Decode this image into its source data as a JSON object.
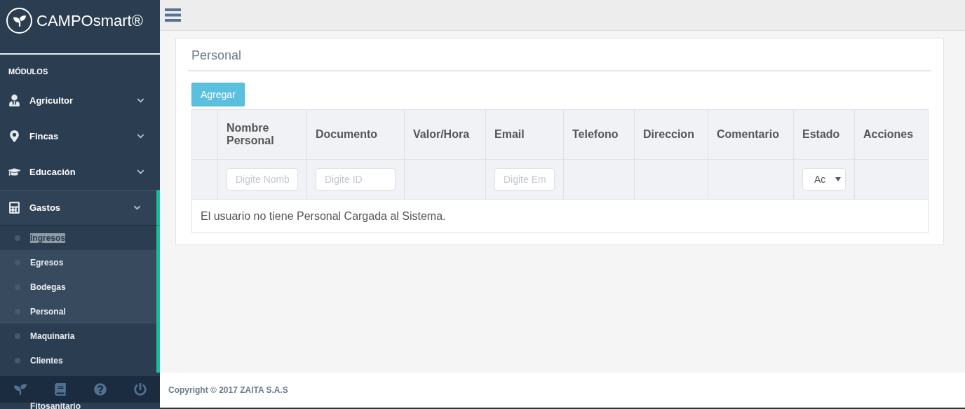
{
  "brand": {
    "name": "CAMPOsmart®"
  },
  "sidebar": {
    "section_title": "MÓDULOS",
    "items": [
      {
        "kind": "person",
        "label": "Agricultor",
        "expanded": false
      },
      {
        "kind": "pin",
        "label": "Fincas",
        "expanded": false
      },
      {
        "kind": "cap",
        "label": "Educación",
        "expanded": false
      },
      {
        "kind": "calculator",
        "label": "Gastos",
        "expanded": true,
        "children": [
          {
            "label": "Ingresos",
            "shaded": false,
            "text_selected": true
          },
          {
            "label": "Egresos",
            "shaded": true,
            "text_selected": false
          },
          {
            "label": "Bodegas",
            "shaded": true,
            "text_selected": false
          },
          {
            "label": "Personal",
            "shaded": true,
            "text_selected": false
          },
          {
            "label": "Maquinaria",
            "shaded": false,
            "text_selected": false
          },
          {
            "label": "Clientes",
            "shaded": false,
            "text_selected": false
          }
        ]
      }
    ],
    "below_bar_item": "Fitosanitario"
  },
  "panel": {
    "title": "Personal",
    "add_button": "Agregar",
    "table": {
      "columns": [
        "",
        "Nombre Personal",
        "Documento",
        "Valor/Hora",
        "Email",
        "Telefono",
        "Direccion",
        "Comentario",
        "Estado",
        "Acciones"
      ],
      "filters": [
        {
          "kind": "none"
        },
        {
          "kind": "input",
          "placeholder": "Digite Nomb"
        },
        {
          "kind": "input",
          "placeholder": "Digite ID"
        },
        {
          "kind": "none"
        },
        {
          "kind": "input",
          "placeholder": "Digite Em"
        },
        {
          "kind": "none"
        },
        {
          "kind": "none"
        },
        {
          "kind": "none"
        },
        {
          "kind": "select",
          "value": "Ac"
        },
        {
          "kind": "none"
        }
      ],
      "empty_message": "El usuario no tiene Personal Cargada al Sistema."
    }
  },
  "footer": {
    "text": "Copyright © 2017 ZAITA S.A.S"
  }
}
